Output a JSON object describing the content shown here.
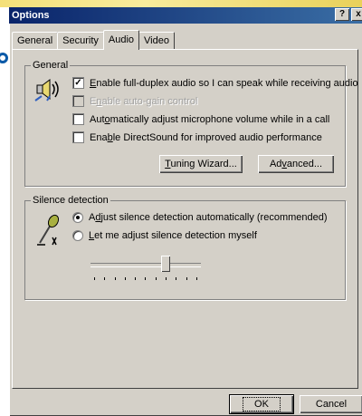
{
  "window": {
    "title": "Options",
    "help_btn": "?",
    "close_btn": "x"
  },
  "tabs": [
    {
      "label": "General",
      "active": false
    },
    {
      "label": "Security",
      "active": false
    },
    {
      "label": "Audio",
      "active": true
    },
    {
      "label": "Video",
      "active": false
    }
  ],
  "general": {
    "legend": "General",
    "icon": "speaker-icon",
    "options": [
      {
        "pre": "",
        "key": "E",
        "post": "nable full-duplex audio so I can speak while receiving audio",
        "checked": true,
        "enabled": true
      },
      {
        "pre": "E",
        "key": "n",
        "post": "able auto-gain control",
        "checked": false,
        "enabled": false
      },
      {
        "pre": "Aut",
        "key": "o",
        "post": "matically adjust microphone volume while in a call",
        "checked": false,
        "enabled": true
      },
      {
        "pre": "Ena",
        "key": "b",
        "post": "le DirectSound for improved audio performance",
        "checked": false,
        "enabled": true
      }
    ],
    "tuning_btn": {
      "pre": "",
      "key": "T",
      "post": "uning Wizard..."
    },
    "advanced_btn": {
      "pre": "Ad",
      "key": "v",
      "post": "anced..."
    }
  },
  "silence": {
    "legend": "Silence detection",
    "icon": "microphone-icon",
    "options": [
      {
        "pre": "A",
        "key": "d",
        "post": "just silence detection automatically (recommended)",
        "selected": true
      },
      {
        "pre": "",
        "key": "L",
        "post": "et me adjust silence detection myself",
        "selected": false
      }
    ],
    "slider_level": 0.7,
    "tick_count": 11
  },
  "footer": {
    "ok": "OK",
    "cancel": "Cancel"
  }
}
